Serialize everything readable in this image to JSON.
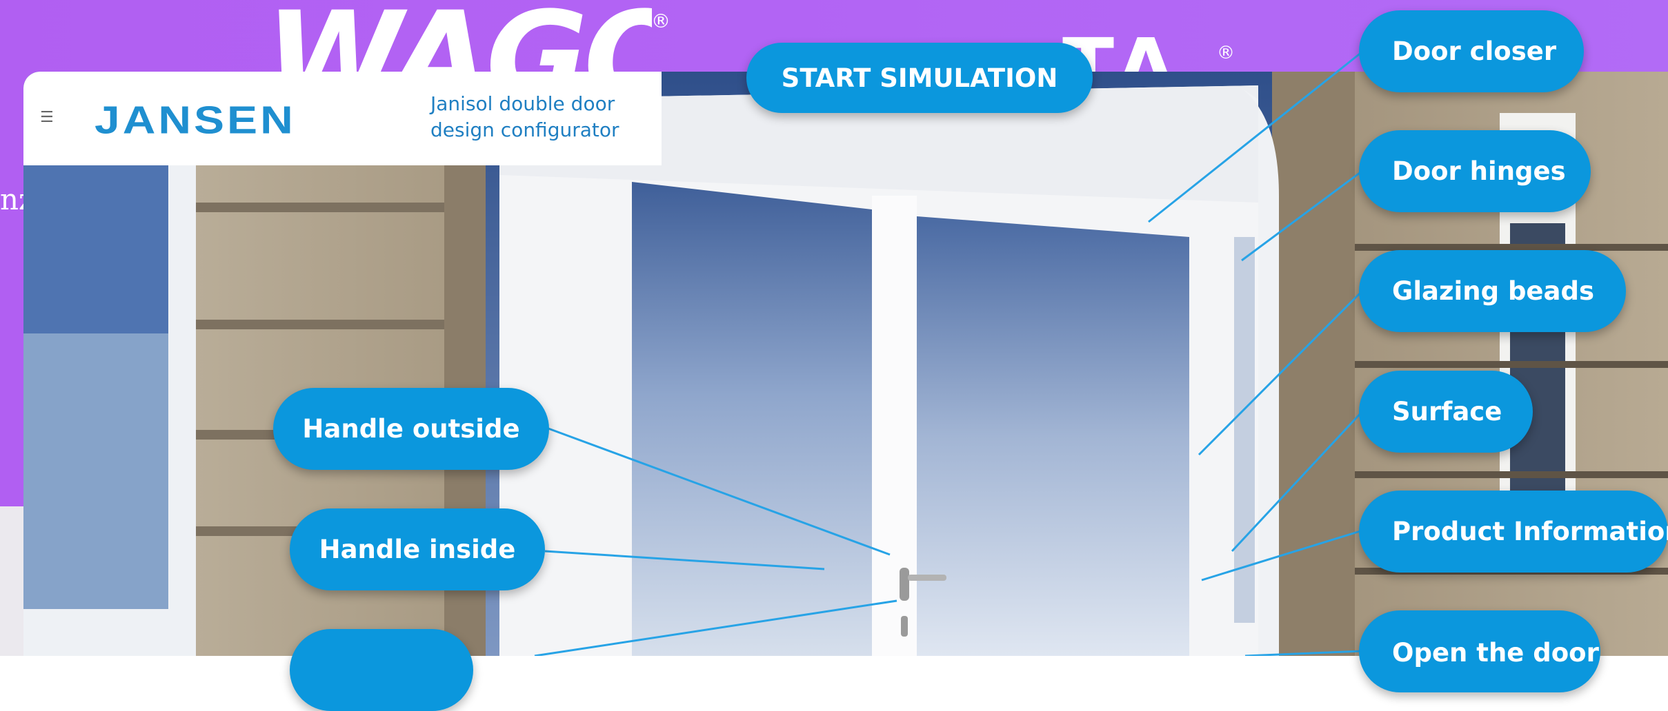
{
  "background": {
    "logo_text": "WAGO",
    "logo_registered": "®",
    "logo_right_text": "TA",
    "logo_right_registered": "®",
    "side_text": "nz"
  },
  "header": {
    "brand": "JANSEN",
    "subtitle": "Janisol double door design configurator",
    "menu_icon": "☰"
  },
  "actions": {
    "start_simulation": "START SIMULATION"
  },
  "callouts_left": [
    {
      "label": "Handle outside"
    },
    {
      "label": "Handle inside"
    },
    {
      "label": ""
    }
  ],
  "callouts_right": [
    {
      "label": "Door closer"
    },
    {
      "label": "Door hinges"
    },
    {
      "label": "Glazing beads"
    },
    {
      "label": "Surface"
    },
    {
      "label": "Product Information"
    },
    {
      "label": "Open the door"
    }
  ],
  "colors": {
    "accent": "#0b97dd",
    "brand": "#1f8fd0",
    "background_band": "#b264f4"
  }
}
